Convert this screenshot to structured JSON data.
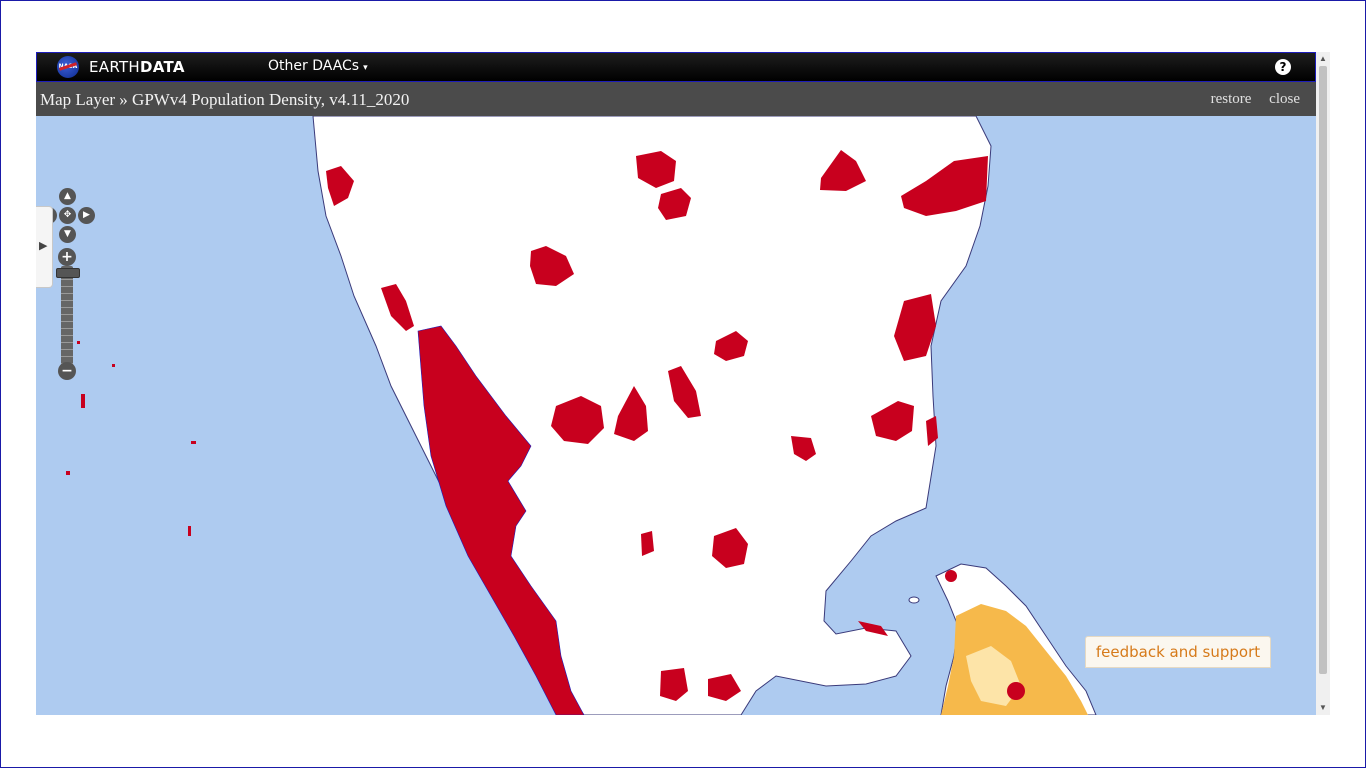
{
  "header": {
    "logo_text": "NASA",
    "brand_thin": "EARTH",
    "brand_bold": "DATA",
    "daacs_label": "Other DAACs",
    "daacs_caret": "▾",
    "help_glyph": "?"
  },
  "layer_bar": {
    "title": "Map Layer » GPWv4 Population Density, v4.11_2020",
    "restore_label": "restore",
    "close_label": "close"
  },
  "controls": {
    "pan_up": "▲",
    "pan_down": "▼",
    "pan_left": "◀",
    "pan_right": "▶",
    "pan_center": "✥",
    "zoom_in": "+",
    "zoom_out": "−",
    "side_tab_arrow": "▶"
  },
  "feedback_label": "feedback and support",
  "colors": {
    "ocean": "#aecbf0",
    "land": "#ffffff",
    "high_density": "#c8001e",
    "medium_density": "#f6b94b",
    "light_density": "#fde4a8"
  },
  "icons": {
    "help": "question-icon",
    "pan": "pan-arrows-icon",
    "zoom_in": "plus-icon",
    "zoom_out": "minus-icon",
    "side_tab": "chevron-right-icon"
  }
}
